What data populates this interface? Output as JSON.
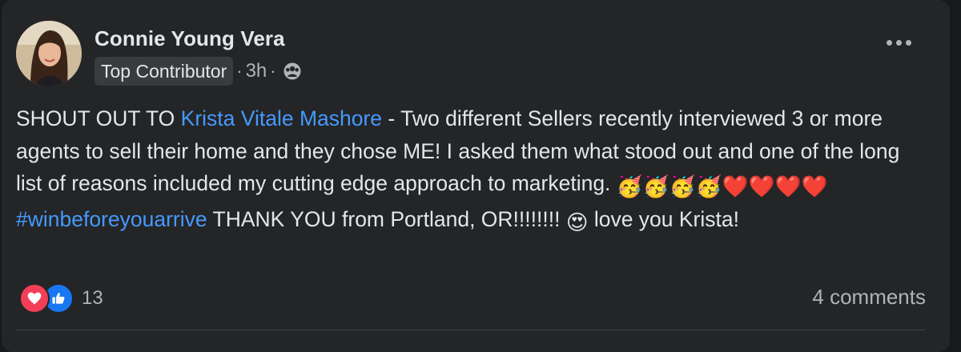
{
  "post": {
    "author": "Connie Young Vera",
    "badge": "Top Contributor",
    "time": "3h",
    "separator": "·",
    "audience_icon": "group-audience-icon",
    "more_icon": "more-options-icon",
    "body": {
      "intro": "SHOUT OUT TO ",
      "mention": "Krista Vitale Mashore",
      "text1": " - Two different Sellers recently interviewed 3 or more agents to sell their home and they chose ME! I asked them what stood out and one of the long list of reasons included my cutting edge approach to marketing. ",
      "emojis_party": "🥳🥳🥳🥳",
      "emojis_hearts": "❤️❤️❤️❤️",
      "hashtag": "#winbeforeyouarrive",
      "text2": " THANK YOU from Portland, OR!!!!!!!! ",
      "emoji_heart_eyes": "😍",
      "text3": " love you Krista!"
    },
    "reactions": {
      "types": [
        "love",
        "like"
      ],
      "count": "13"
    },
    "comments": "4 comments"
  },
  "colors": {
    "background": "#18191a",
    "card": "#242526",
    "text": "#e4e6eb",
    "secondary_text": "#b0b3b8",
    "link": "#4599ff",
    "love": "#f33e58",
    "like": "#1877f2"
  }
}
